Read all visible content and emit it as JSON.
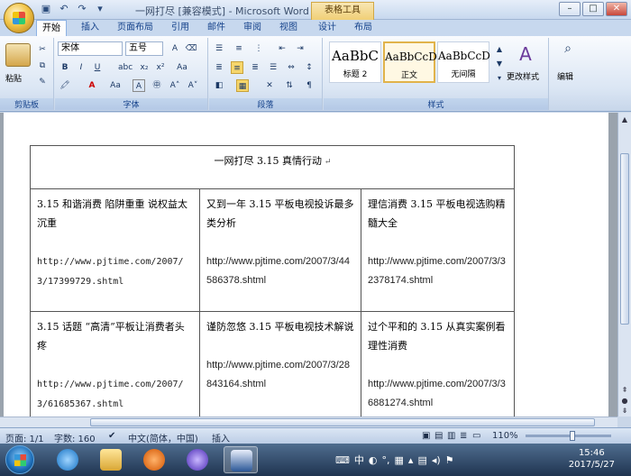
{
  "window": {
    "title": "一网打尽 [兼容模式] - Microsoft Word",
    "context_tab": "表格工具"
  },
  "ribbon_tabs": [
    "开始",
    "插入",
    "页面布局",
    "引用",
    "邮件",
    "审阅",
    "视图",
    "设计",
    "布局"
  ],
  "ribbon": {
    "clipboard": {
      "paste_label": "粘贴",
      "group_label": "剪贴板"
    },
    "font": {
      "font_name": "宋体",
      "font_size": "五号",
      "group_label": "字体"
    },
    "paragraph": {
      "group_label": "段落"
    },
    "styles": {
      "items": [
        {
          "sample": "AaBbC",
          "name": "标题 2"
        },
        {
          "sample": "AaBbCcD",
          "name": "正文"
        },
        {
          "sample": "AaBbCcD",
          "name": "无间隔"
        }
      ],
      "change_styles_label": "更改样式",
      "group_label": "样式"
    },
    "editing": {
      "label": "编辑"
    }
  },
  "document": {
    "table_title": "一网打尽   3.15 真情行动",
    "rows": [
      [
        {
          "title": "3.15 和谐消费 陷阱重重 说权益太沉重",
          "url": "http://www.pjtime.com/2007/3/17399729.shtml",
          "mono": true
        },
        {
          "title": "又到一年 3.15 平板电视投诉最多类分析",
          "url": "http://www.pjtime.com/2007/3/44586378.shtml",
          "mono": false
        },
        {
          "title": "理信消费 3.15 平板电视选购精髓大全",
          "url": "http://www.pjtime.com/2007/3/32378174.shtml",
          "mono": false
        }
      ],
      [
        {
          "title": "3.15 话题 “高清”平板让消费者头疼",
          "url": "http://www.pjtime.com/2007/3/61685367.shtml",
          "mono": true
        },
        {
          "title": "谨防忽悠 3.15 平板电视技术解说",
          "url": "http://www.pjtime.com/2007/3/28843164.shtml",
          "mono": false
        },
        {
          "title": "过个平和的 3.15 从真实案例看理性消费",
          "url": "http://www.pjtime.com/2007/3/36881274.shtml",
          "mono": false
        }
      ]
    ]
  },
  "statusbar": {
    "page": "页面: 1/1",
    "words": "字数: 160",
    "language": "中文(简体，中国)",
    "mode": "插入",
    "zoom": "110%"
  },
  "taskbar": {
    "ime": "中",
    "time": "15:46",
    "date": "2017/5/27"
  },
  "colors": {
    "ribbon_label": "#15428b",
    "context_tab": "#f0cf76",
    "taskbar": "#1f3450"
  }
}
